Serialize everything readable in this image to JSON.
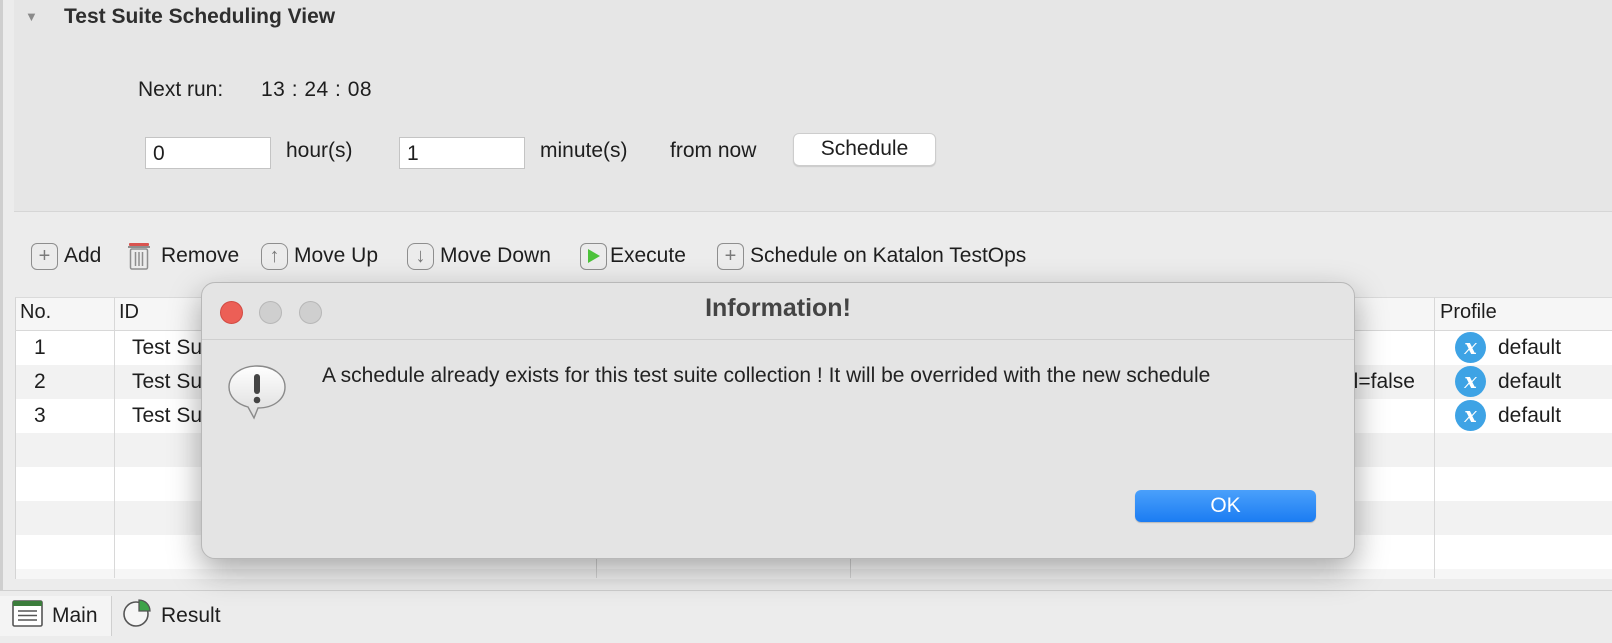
{
  "section": {
    "toggle_glyph": "▼",
    "title": "Test Suite Scheduling View",
    "next_run_label": "Next run:",
    "next_run_value": "13 : 24 : 08",
    "hours_value": "0",
    "hours_label": "hour(s)",
    "minutes_value": "1",
    "minutes_label": "minute(s)",
    "from_now_label": "from now",
    "schedule_button": "Schedule"
  },
  "toolbar": {
    "add": "Add",
    "remove": "Remove",
    "move_up": "Move Up",
    "move_down": "Move Down",
    "execute": "Execute",
    "schedule_testops": "Schedule on Katalon TestOps"
  },
  "table": {
    "headers": {
      "no": "No.",
      "id": "ID",
      "profile": "Profile"
    },
    "rows": [
      {
        "no": "1",
        "id": "Test Su",
        "profile": "default",
        "extra": ""
      },
      {
        "no": "2",
        "id": "Test Su",
        "profile": "default",
        "extra": "el=false"
      },
      {
        "no": "3",
        "id": "Test Su",
        "profile": "default",
        "extra": ""
      }
    ]
  },
  "tabs": {
    "main": "Main",
    "result": "Result"
  },
  "dialog": {
    "title": "Information!",
    "message": "A schedule already exists for this test suite collection ! It will be overrided with the new schedule",
    "ok_button": "OK"
  },
  "colors": {
    "accent_blue": "#1b7cf2",
    "profile_badge": "#3ea3e5",
    "close_red": "#ec5f56",
    "execute_green": "#4cc23a"
  }
}
